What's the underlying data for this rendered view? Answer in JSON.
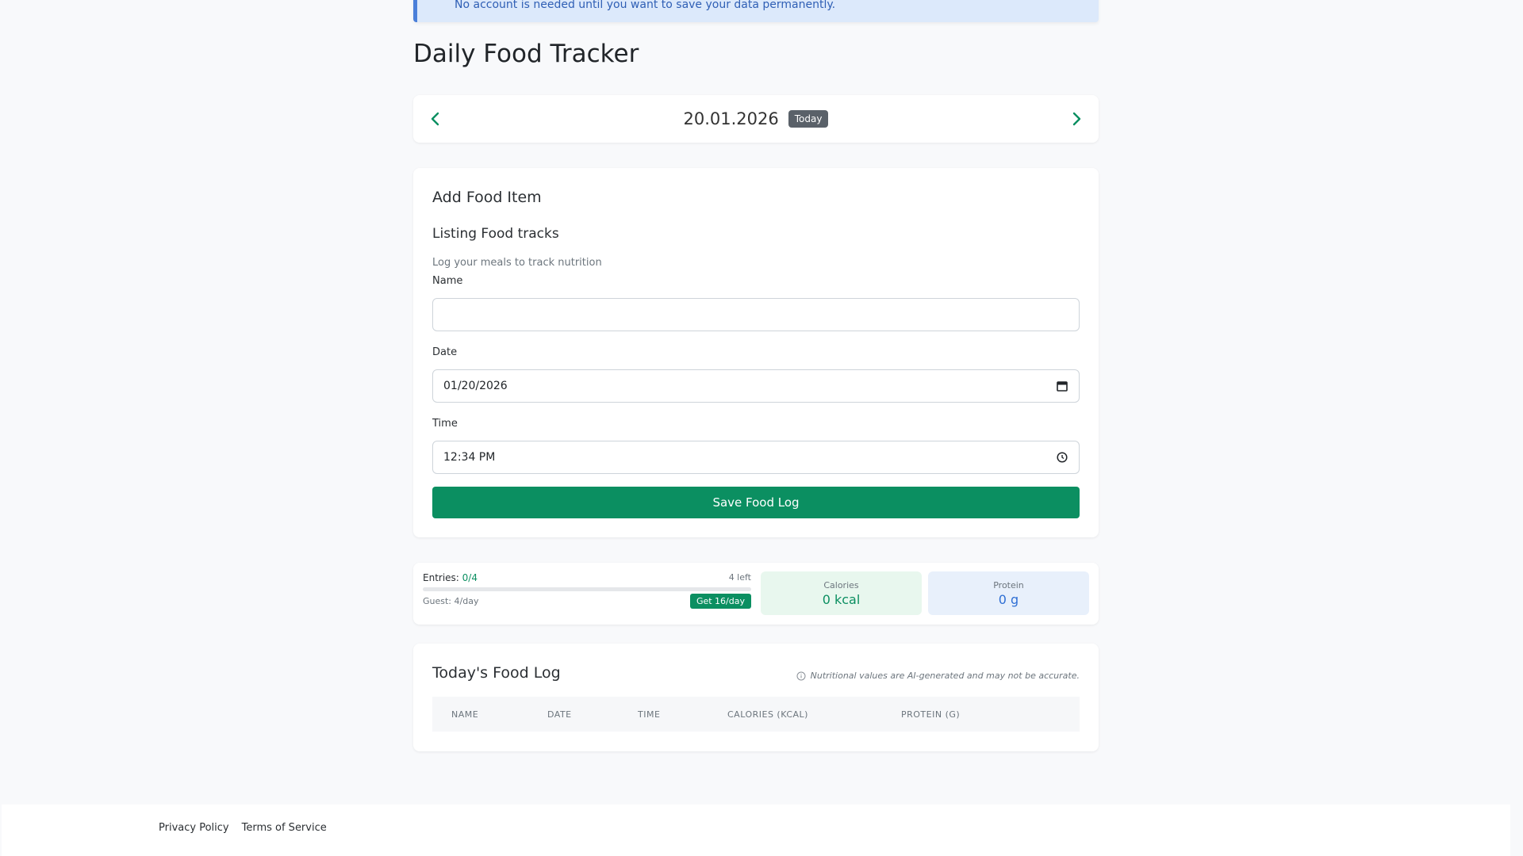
{
  "alert": {
    "text": "No account is needed until you want to save your data permanently."
  },
  "page": {
    "title": "Daily Food Tracker"
  },
  "date_nav": {
    "date": "20.01.2026",
    "badge": "Today"
  },
  "form": {
    "heading": "Add Food Item",
    "subheading": "Listing Food tracks",
    "description": "Log your meals to track nutrition",
    "name_label": "Name",
    "name_value": "",
    "date_label": "Date",
    "date_value": "01/20/2026",
    "time_label": "Time",
    "time_value": "12:34 PM",
    "save_label": "Save Food Log"
  },
  "stats": {
    "entries_label": "Entries:",
    "entries_count": "0/4",
    "entries_fraction": 0,
    "left": "4 left",
    "guest": "Guest: 4/day",
    "upgrade": "Get 16/day",
    "calories_label": "Calories",
    "calories_value": "0 kcal",
    "protein_label": "Protein",
    "protein_value": "0 g"
  },
  "log": {
    "title": "Today's Food Log",
    "disclaimer": "Nutritional values are AI-generated and may not be accurate.",
    "columns": [
      "NAME",
      "DATE",
      "TIME",
      "CALORIES (KCAL)",
      "PROTEIN (G)"
    ]
  },
  "footer": {
    "privacy": "Privacy Policy",
    "terms": "Terms of Service"
  },
  "colors": {
    "accent": "#0b8f61",
    "info": "#2f6fd4",
    "badge": "#5a6169"
  },
  "icons": {
    "prev": "chevron-left-icon",
    "next": "chevron-right-icon",
    "calendar": "calendar-icon",
    "clock": "clock-icon",
    "info": "info-icon"
  }
}
